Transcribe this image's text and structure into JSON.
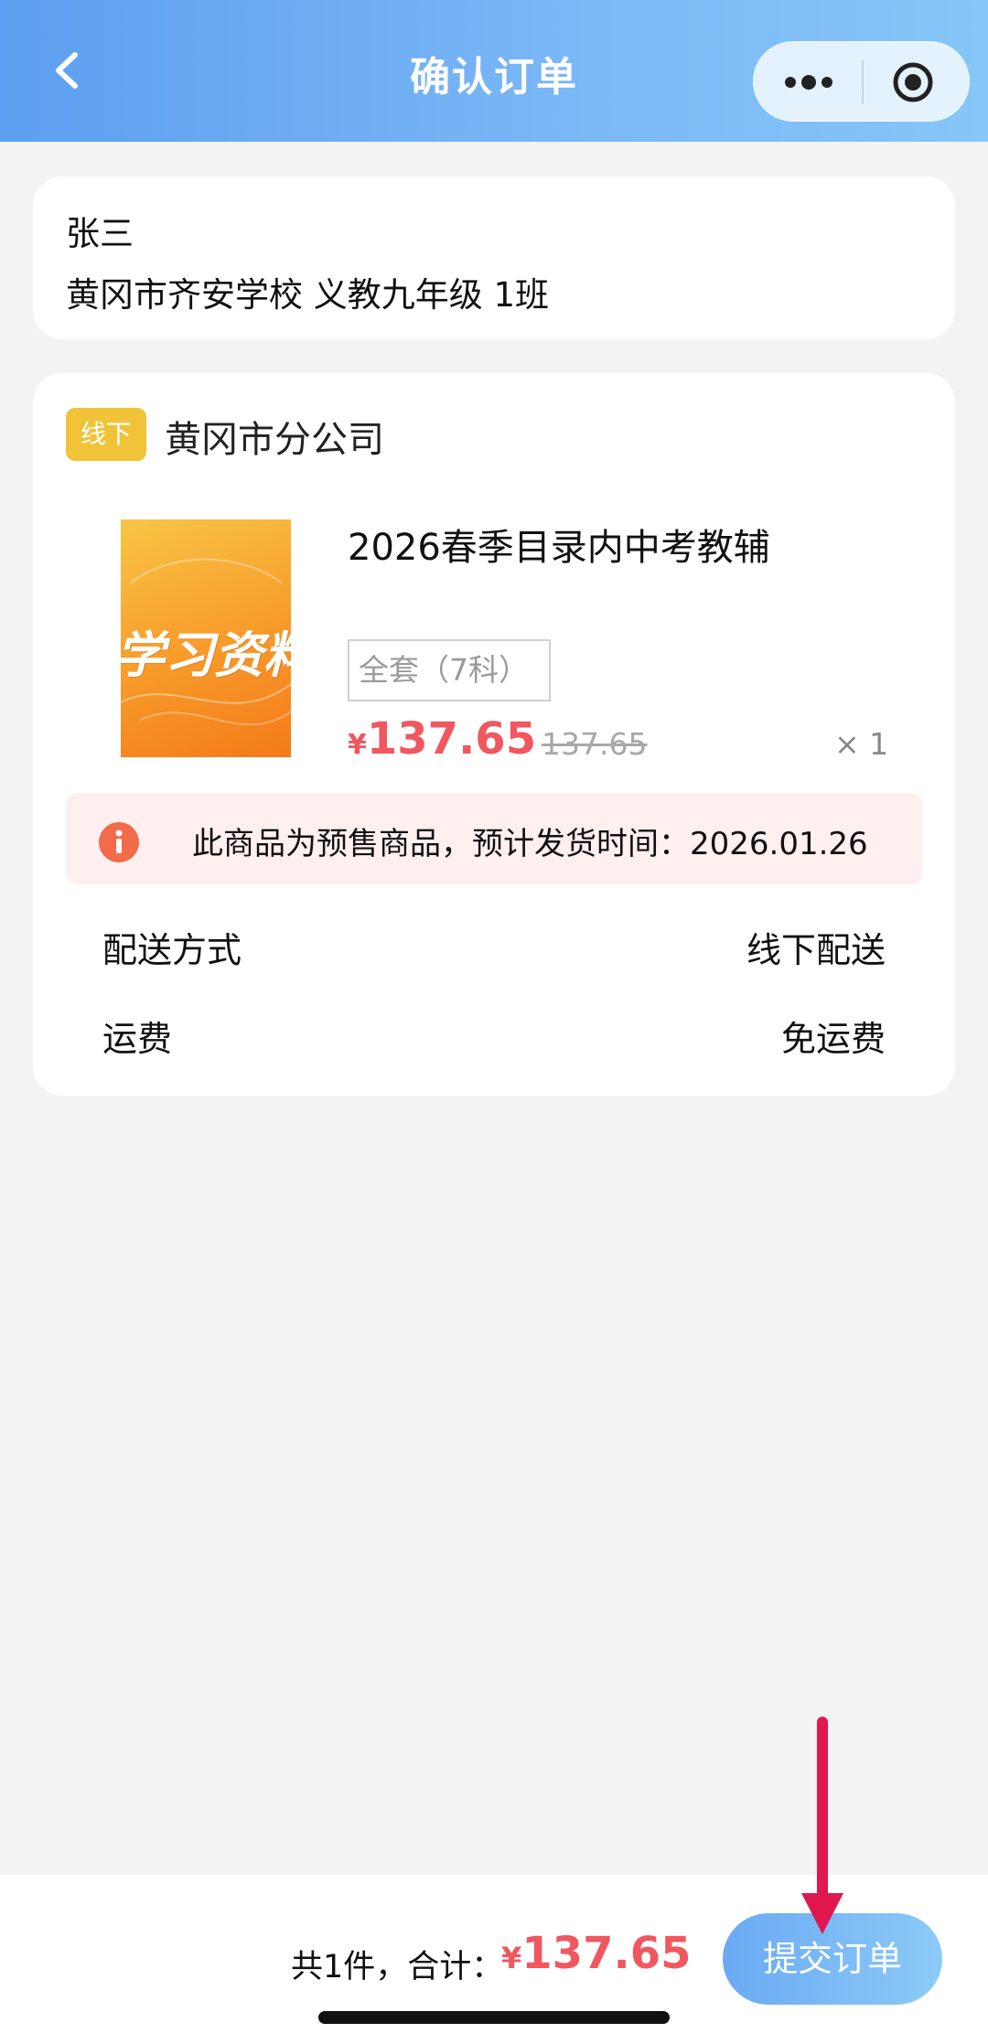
{
  "header": {
    "title": "确认订单",
    "back_icon": "chevron-left-icon",
    "more_icon": "more-dots-icon",
    "close_icon": "target-circle-icon"
  },
  "address": {
    "name": "张三",
    "detail": "黄冈市齐安学校 义教九年级 1班"
  },
  "order": {
    "badge": "线下",
    "store": "黄冈市分公司",
    "product": {
      "cover_text": "学习资料",
      "title": "2026春季目录内中考教辅",
      "spec": "全套（7科）",
      "currency": "¥",
      "price": "137.65",
      "original_price": "137.65",
      "quantity": "× 1"
    },
    "notice": {
      "icon": "info-icon",
      "text": "此商品为预售商品，预计发货时间：2026.01.26"
    },
    "delivery": {
      "label": "配送方式",
      "value": "线下配送"
    },
    "shipping": {
      "label": "运费",
      "value": "免运费"
    }
  },
  "footer": {
    "summary": "共1件，合计：",
    "currency": "¥",
    "total": "137.65",
    "submit_label": "提交订单"
  },
  "colors": {
    "header_gradient_start": "#5d9ff0",
    "price_red": "#f0575e",
    "badge_yellow": "#f0c338",
    "notice_bg": "#fff0ef",
    "annotation_arrow": "#e0184f"
  }
}
